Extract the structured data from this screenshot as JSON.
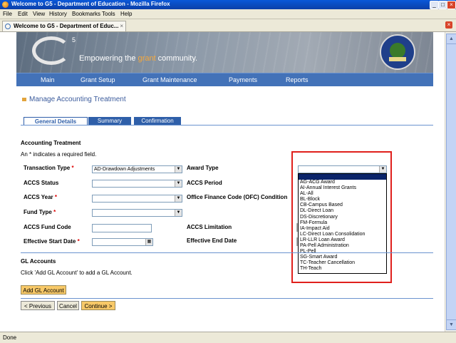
{
  "window": {
    "title": "Welcome to G5 - Department of Education - Mozilla Firefox"
  },
  "menu": [
    "File",
    "Edit",
    "View",
    "History",
    "Bookmarks",
    "Tools",
    "Help"
  ],
  "browser_tab": {
    "label": "Welcome to G5 - Department of Educ..."
  },
  "banner": {
    "logo_sup": "5",
    "tagline_pre": "Empowering the ",
    "tagline_accent": "grant",
    "tagline_post": " community."
  },
  "nav": [
    "Main",
    "Grant Setup",
    "Grant Maintenance",
    "Payments",
    "Reports"
  ],
  "page_title": "Manage Accounting Treatment",
  "tabs": [
    "General Details",
    "Summary",
    "Confirmation"
  ],
  "section_title": "Accounting Treatment",
  "required_note": "An * indicates a required field.",
  "fields": {
    "transaction_type": {
      "label": "Transaction Type",
      "value": "AD-Drawdown Adjustments"
    },
    "accs_status": {
      "label": "ACCS Status"
    },
    "accs_year": {
      "label": "ACCS Year"
    },
    "fund_type": {
      "label": "Fund Type"
    },
    "accs_fund_code": {
      "label": "ACCS Fund Code"
    },
    "effective_start_date": {
      "label": "Effective Start Date"
    },
    "award_type": {
      "label": "Award Type"
    },
    "accs_period": {
      "label": "ACCS Period"
    },
    "ofc": {
      "label": "Office Finance Code (OFC) Condition"
    },
    "accs_limitation": {
      "label": "ACCS Limitation"
    },
    "effective_end_date": {
      "label": "Effective End Date"
    },
    "required_mark": "*"
  },
  "award_type_options": [
    "AG-ACG Award",
    "AI-Annual Interest Grants",
    "AL-All",
    "BL-Block",
    "CB-Campus Based",
    "DL-Direct Loan",
    "DS-Discretionary",
    "FM-Formula",
    "IA-Impact Aid",
    "LC-Direct Loan Consolidation",
    "LR-LLR Loan Award",
    "PA-Pell Administration",
    "PL-Pell",
    "SG-Smart Award",
    "TC-Teacher Cancellation",
    "TH-Teach"
  ],
  "gl": {
    "title": "GL Accounts",
    "hint": "Click 'Add GL Account' to add a GL Account.",
    "add_button": "Add GL Account"
  },
  "buttons": {
    "previous": "< Previous",
    "cancel": "Cancel",
    "continue": "Continue >"
  },
  "status": "Done",
  "colors": {
    "nav": "#4372b8",
    "accent_orange": "#f8c968",
    "highlight": "#e0201c"
  }
}
